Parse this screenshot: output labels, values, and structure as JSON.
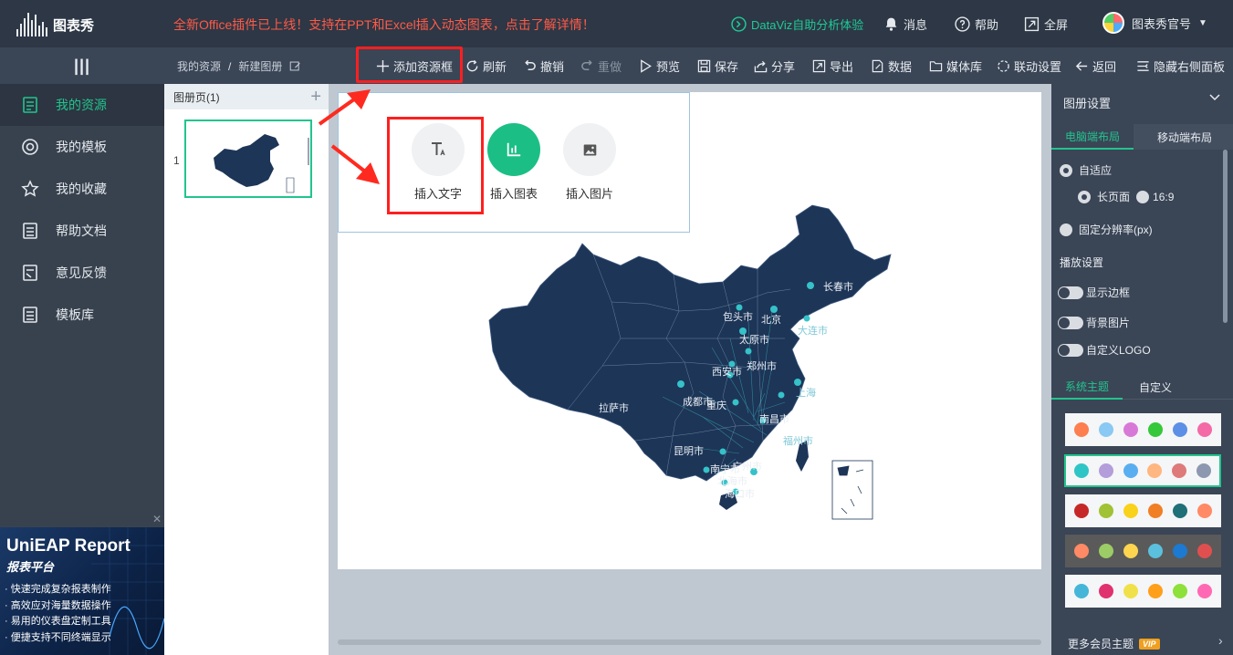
{
  "header": {
    "logo_text": "图表秀",
    "banner": "全新Office插件已上线！支持在PPT和Excel插入动态图表，点击了解详情！",
    "dataviz": "DataViz自助分析体验",
    "messages": "消息",
    "help": "帮助",
    "fullscreen": "全屏",
    "account": "图表秀官号"
  },
  "breadcrumb": {
    "root": "我的资源",
    "separator": "/",
    "current": "新建图册"
  },
  "toolbar": {
    "add_frame": "添加资源框",
    "refresh": "刷新",
    "undo": "撤销",
    "redo": "重做",
    "preview": "预览",
    "save": "保存",
    "share": "分享",
    "export": "导出",
    "data": "数据",
    "media": "媒体库",
    "linkage": "联动设置",
    "back": "返回",
    "hide_panel": "隐藏右侧面板"
  },
  "sidebar": {
    "items": [
      {
        "label": "我的资源",
        "icon": "resource-icon",
        "active": true
      },
      {
        "label": "我的模板",
        "icon": "template-icon",
        "active": false
      },
      {
        "label": "我的收藏",
        "icon": "star-icon",
        "active": false
      },
      {
        "label": "帮助文档",
        "icon": "doc-icon",
        "active": false
      },
      {
        "label": "意见反馈",
        "icon": "feedback-icon",
        "active": false
      },
      {
        "label": "模板库",
        "icon": "library-icon",
        "active": false
      }
    ]
  },
  "ad": {
    "title": "UniEAP Report",
    "subtitle": "报表平台",
    "bullets": [
      "快速完成复杂报表制作",
      "高效应对海量数据操作",
      "易用的仪表盘定制工具",
      "便捷支持不同终端显示"
    ],
    "close": "✕"
  },
  "pages_panel": {
    "title": "图册页(1)",
    "page_number": "1"
  },
  "insert_popup": {
    "text": "插入文字",
    "chart": "插入图表",
    "image": "插入图片"
  },
  "map": {
    "cities": [
      "长春市",
      "包头市",
      "北京",
      "大连市",
      "太原市",
      "郑州市",
      "西安市",
      "拉萨市",
      "成都市",
      "重庆",
      "南昌市",
      "上海",
      "福州市",
      "昆明市",
      "南宁市",
      "广州市",
      "北海市",
      "海口市"
    ]
  },
  "right_panel": {
    "title": "图册设置",
    "tabs": [
      "电脑端布局",
      "移动端布局"
    ],
    "adaptive": "自适应",
    "long_page": "长页面",
    "ratio": "16:9",
    "fixed_res": "固定分辨率(px)",
    "play_settings": "播放设置",
    "show_border": "显示边框",
    "bg_image": "背景图片",
    "custom_logo": "自定义LOGO",
    "theme_tabs": [
      "系统主题",
      "自定义"
    ],
    "more_themes": "更多会员主题",
    "vip": "VIP",
    "palettes": [
      [
        "#fd7e4f",
        "#89c9f4",
        "#d879d8",
        "#34c83a",
        "#5c8fe6",
        "#f36aa6"
      ],
      [
        "#2ec5c6",
        "#b39ddb",
        "#59aef0",
        "#ffb680",
        "#de7a7a",
        "#8d98b0"
      ],
      [
        "#c62828",
        "#a0c234",
        "#f9d21b",
        "#f07f25",
        "#1f7077",
        "#ff8a65"
      ],
      [
        "#ff8a65",
        "#9ccc65",
        "#ffd54f",
        "#5bc0de",
        "#1d7ad0",
        "#e04f4f"
      ],
      [
        "#45b6d8",
        "#e0326e",
        "#f0e14a",
        "#ff9f1a",
        "#8ee03a",
        "#ff69b4"
      ]
    ]
  }
}
